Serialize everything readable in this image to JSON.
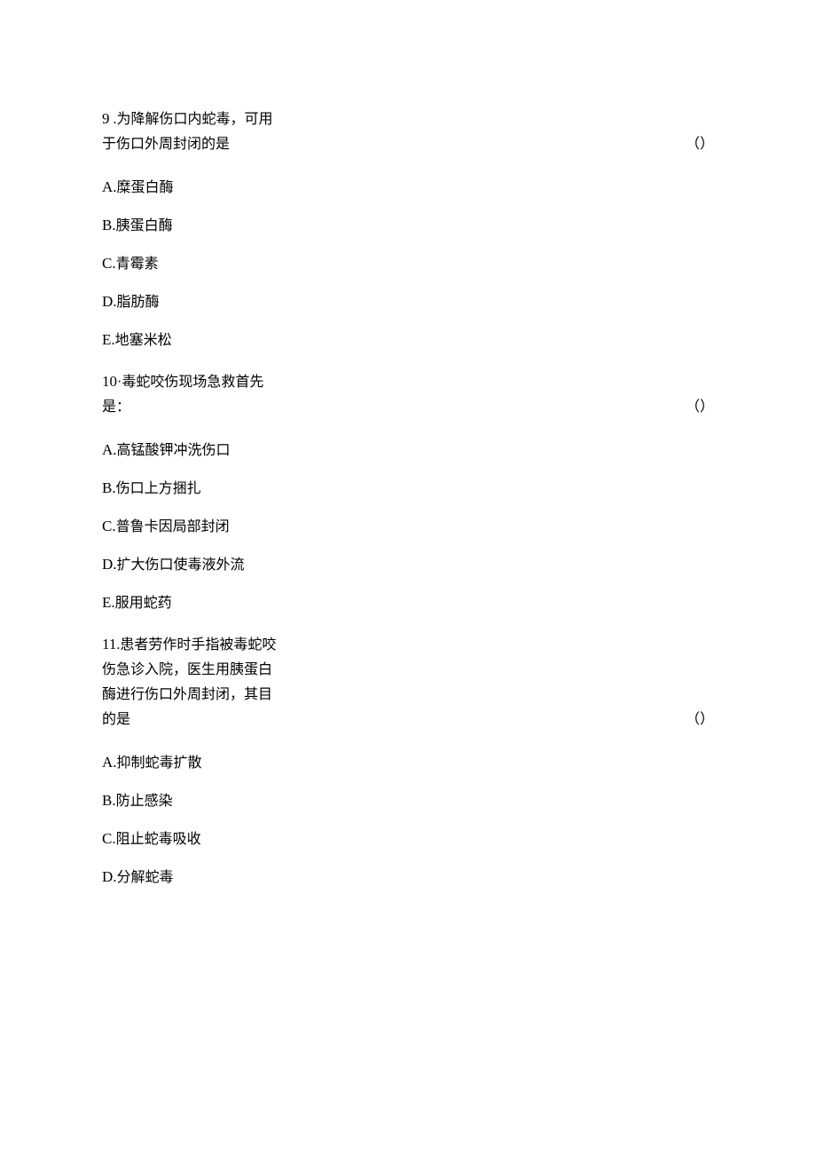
{
  "questions": [
    {
      "number": "9",
      "sep": " .",
      "stem": "为降解伤口内蛇毒，可用于伤口外周封闭的是",
      "paren": "（）",
      "options": [
        {
          "label": "A.",
          "text": "糜蛋白酶"
        },
        {
          "label": "B.",
          "text": "胰蛋白酶"
        },
        {
          "label": "C.",
          "text": "青霉素"
        },
        {
          "label": "D.",
          "text": "脂肪酶"
        },
        {
          "label": "E.",
          "text": "地塞米松"
        }
      ]
    },
    {
      "number": "10",
      "sep": "·",
      "stem": "毒蛇咬伤现场急救首先是：",
      "paren": "（）",
      "options": [
        {
          "label": "A.",
          "text": "高锰酸钾冲洗伤口"
        },
        {
          "label": "B.",
          "text": "伤口上方捆扎"
        },
        {
          "label": "C.",
          "text": "普鲁卡因局部封闭"
        },
        {
          "label": "D.",
          "text": "扩大伤口使毒液外流"
        },
        {
          "label": "E.",
          "text": "服用蛇药"
        }
      ]
    },
    {
      "number": "11",
      "sep": ".",
      "stem": "患者劳作时手指被毒蛇咬伤急诊入院，医生用胰蛋白酶进行伤口外周封闭，其目的是",
      "paren": "（）",
      "options": [
        {
          "label": "A.",
          "text": "抑制蛇毒扩散"
        },
        {
          "label": "B.",
          "text": "防止感染"
        },
        {
          "label": "C.",
          "text": "阻止蛇毒吸收"
        },
        {
          "label": "D.",
          "text": "分解蛇毒"
        }
      ]
    }
  ]
}
